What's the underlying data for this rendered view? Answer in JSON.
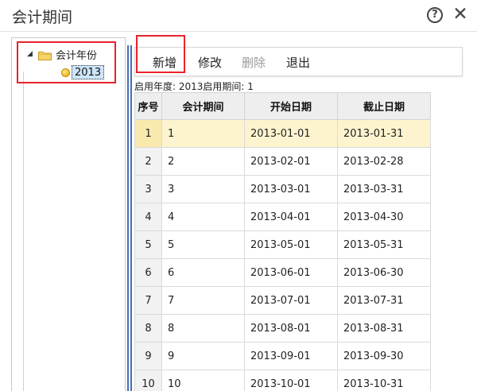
{
  "window": {
    "title": "会计期间"
  },
  "icons": {
    "help": "help-circle-icon",
    "close": "close-icon",
    "folder": "folder-icon",
    "node": "yellow-dot-icon"
  },
  "tree": {
    "root": {
      "label": "会计年份",
      "expander": "◢"
    },
    "children": [
      {
        "label": "2013",
        "selected": true
      }
    ]
  },
  "toolbar": {
    "add": "新增",
    "edit": "修改",
    "delete": "删除",
    "exit": "退出",
    "delete_disabled": true
  },
  "info": {
    "text": "启用年度:  2013启用期间:  1"
  },
  "table": {
    "columns": [
      "序号",
      "会计期间",
      "开始日期",
      "截止日期"
    ],
    "selected_row": 0,
    "rows": [
      [
        "1",
        "1",
        "2013-01-01",
        "2013-01-31"
      ],
      [
        "2",
        "2",
        "2013-02-01",
        "2013-02-28"
      ],
      [
        "3",
        "3",
        "2013-03-01",
        "2013-03-31"
      ],
      [
        "4",
        "4",
        "2013-04-01",
        "2013-04-30"
      ],
      [
        "5",
        "5",
        "2013-05-01",
        "2013-05-31"
      ],
      [
        "6",
        "6",
        "2013-06-01",
        "2013-06-30"
      ],
      [
        "7",
        "7",
        "2013-07-01",
        "2013-07-31"
      ],
      [
        "8",
        "8",
        "2013-08-01",
        "2013-08-31"
      ],
      [
        "9",
        "9",
        "2013-09-01",
        "2013-09-30"
      ],
      [
        "10",
        "10",
        "2013-10-01",
        "2013-10-31"
      ]
    ]
  },
  "colors": {
    "highlight_box": "#e8222b",
    "selected_row": "#fdf4cf",
    "splitter": "#4a70b5",
    "tree_selection": "#cde5fb"
  }
}
